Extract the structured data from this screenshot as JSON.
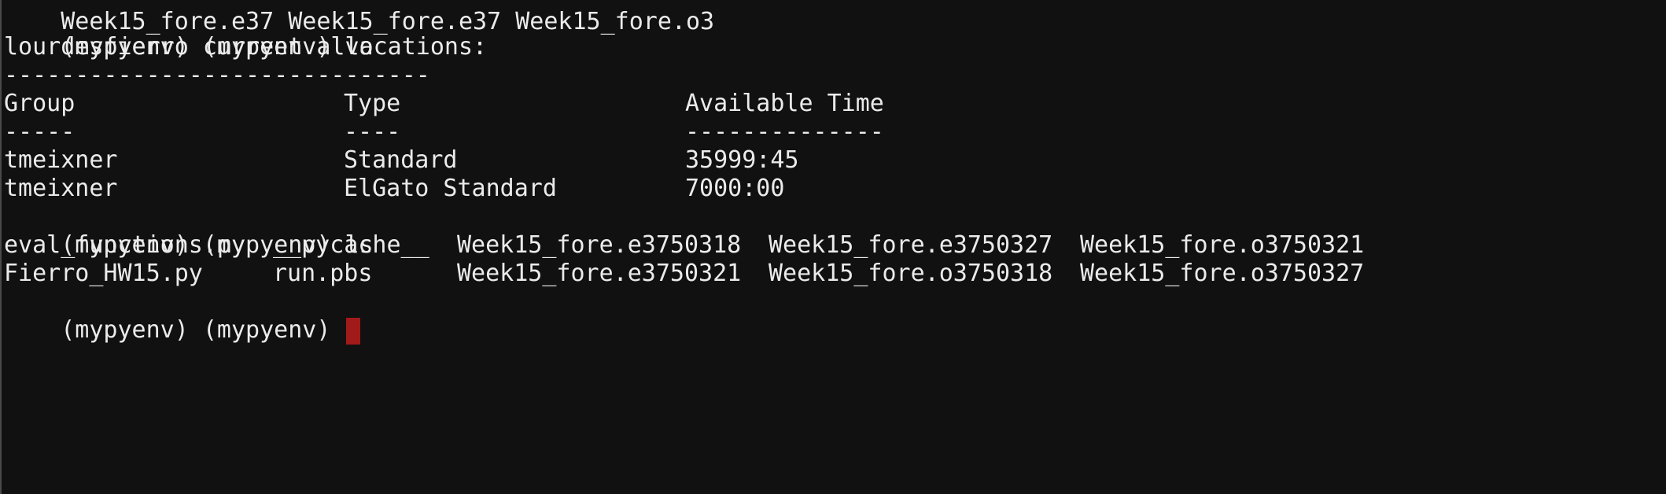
{
  "terminal": {
    "cut_off_top_line": "Week15_fore.e37 Week15_fore.e37 Week15_fore.o3",
    "line1": {
      "prompt": "(mypyenv) (mypyenv)",
      "command": "va"
    },
    "allocations_title": "lourdesfierro current allocations:",
    "title_rule": "------------------------------",
    "table": {
      "headers": [
        "Group",
        "Type",
        "Available Time"
      ],
      "header_rules": [
        "-----",
        "----",
        "--------------"
      ],
      "rows": [
        [
          "tmeixner",
          "Standard",
          "35999:45"
        ],
        [
          "tmeixner",
          "ElGato Standard",
          "7000:00"
        ]
      ]
    },
    "line_ls": {
      "prompt": "(mypyenv) (mypyenv)",
      "command": "ls"
    },
    "ls_output": [
      [
        "eval_functions.py",
        "__pycache__",
        "Week15_fore.e3750318",
        "Week15_fore.e3750327",
        "Week15_fore.o3750321"
      ],
      [
        "Fierro_HW15.py",
        "run.pbs",
        "Week15_fore.e3750321",
        "Week15_fore.o3750318",
        "Week15_fore.o3750327"
      ]
    ],
    "final_prompt": "(mypyenv) (mypyenv)",
    "colors": {
      "background": "#111111",
      "foreground": "#ebebeb",
      "cursor": "#a11a1a"
    }
  }
}
